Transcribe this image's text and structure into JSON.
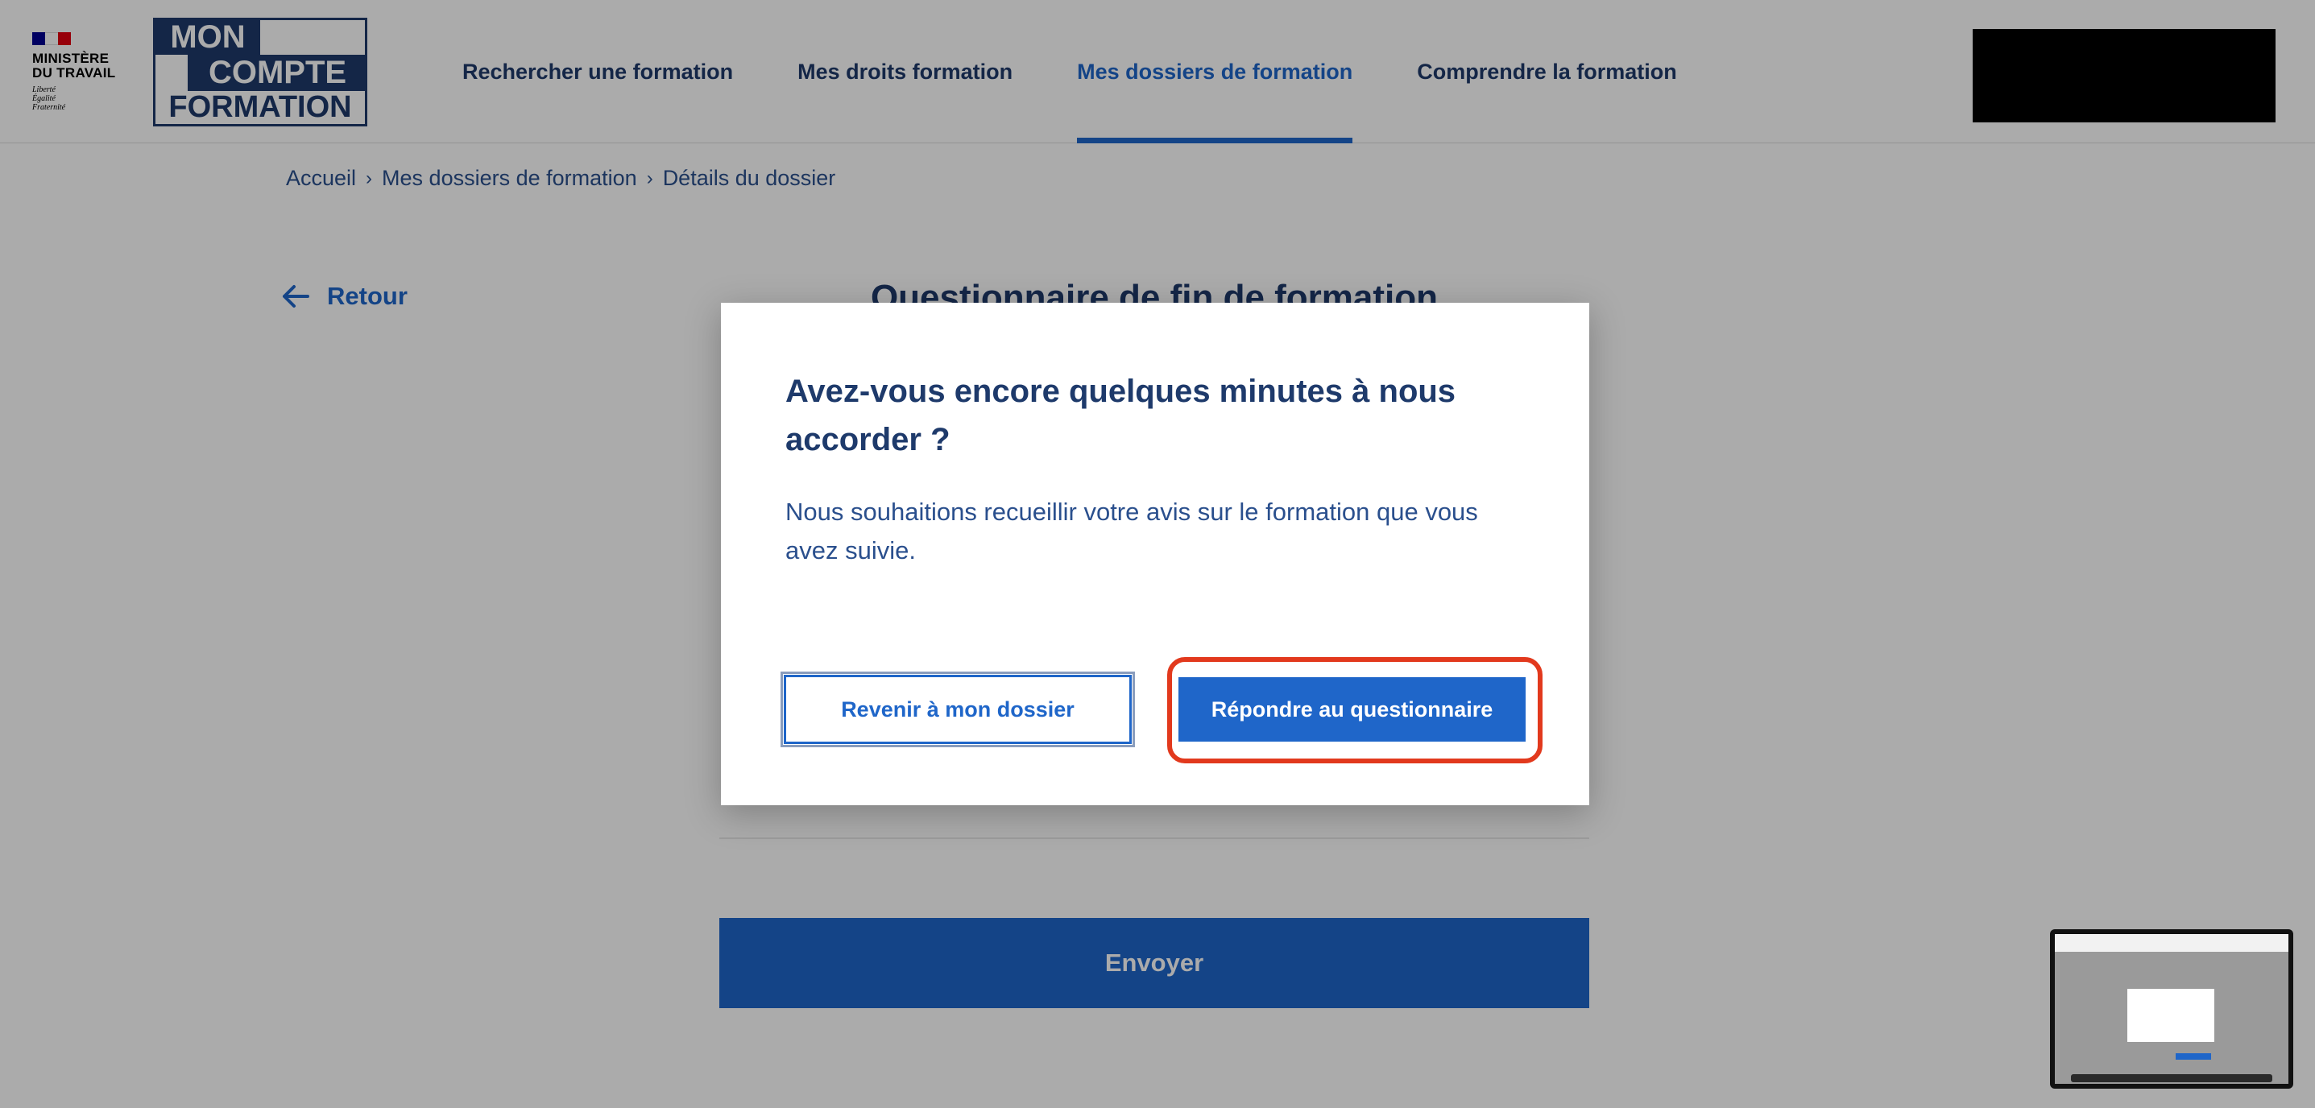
{
  "header": {
    "gov_logo": {
      "name_line1": "MINISTÈRE",
      "name_line2": "DU TRAVAIL",
      "motto_line1": "Liberté",
      "motto_line2": "Égalité",
      "motto_line3": "Fraternité"
    },
    "brand": {
      "line1": "MON",
      "line2": "COMPTE",
      "line3": "FORMATION"
    },
    "nav": [
      {
        "label": "Rechercher une formation",
        "active": false
      },
      {
        "label": "Mes droits formation",
        "active": false
      },
      {
        "label": "Mes dossiers de formation",
        "active": true
      },
      {
        "label": "Comprendre la formation",
        "active": false
      }
    ]
  },
  "breadcrumb": [
    "Accueil",
    "Mes dossiers de formation",
    "Détails du dossier"
  ],
  "back_label": "Retour",
  "page_title": "Questionnaire de fin de formation",
  "send_label": "Envoyer",
  "modal": {
    "title": "Avez-vous encore quelques minutes à nous accorder ?",
    "text": "Nous souhaitions recueillir votre avis sur le formation que vous avez suivie.",
    "secondary_label": "Revenir à mon dossier",
    "primary_label": "Répondre au questionnaire"
  },
  "colors": {
    "primary": "#1f66c9",
    "navy": "#1e3a6b",
    "highlight": "#e2391d"
  }
}
